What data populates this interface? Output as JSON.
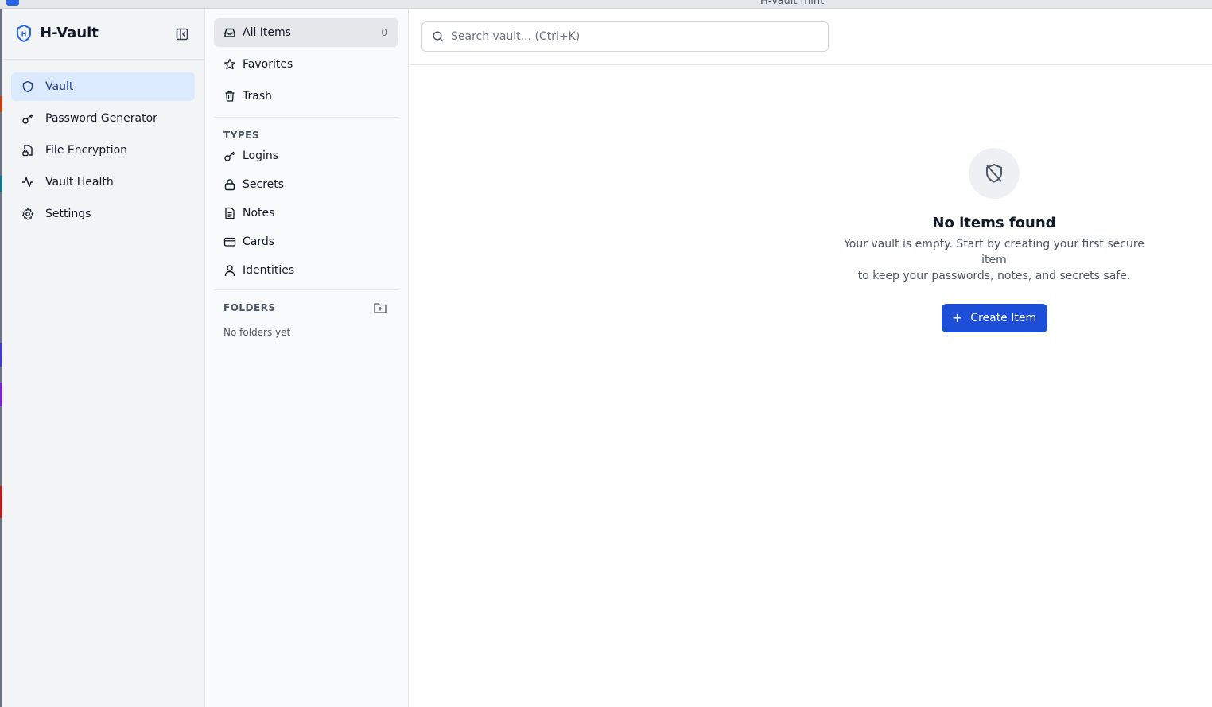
{
  "window": {
    "title": "H-Vault mint"
  },
  "brand": {
    "name": "H-Vault"
  },
  "sidebar": {
    "items": [
      {
        "label": "Vault",
        "icon": "shield-icon",
        "active": true
      },
      {
        "label": "Password Generator",
        "icon": "key-icon"
      },
      {
        "label": "File Encryption",
        "icon": "file-lock-icon"
      },
      {
        "label": "Vault Health",
        "icon": "activity-icon"
      },
      {
        "label": "Settings",
        "icon": "gear-icon"
      }
    ]
  },
  "filters": {
    "items": [
      {
        "label": "All Items",
        "count": "0",
        "icon": "inbox-icon",
        "active": true
      },
      {
        "label": "Favorites",
        "icon": "star-icon"
      },
      {
        "label": "Trash",
        "icon": "trash-icon"
      }
    ],
    "types_label": "TYPES",
    "types": [
      {
        "label": "Logins",
        "icon": "key-icon"
      },
      {
        "label": "Secrets",
        "icon": "lock-icon"
      },
      {
        "label": "Notes",
        "icon": "note-icon"
      },
      {
        "label": "Cards",
        "icon": "credit-card-icon"
      },
      {
        "label": "Identities",
        "icon": "user-icon"
      }
    ],
    "folders_label": "FOLDERS",
    "folders_empty": "No folders yet"
  },
  "search": {
    "placeholder": "Search vault... (Ctrl+K)",
    "value": ""
  },
  "empty_state": {
    "title": "No items found",
    "description_line1": "Your vault is empty. Start by creating your first secure item",
    "description_line2": "to keep your passwords, notes, and secrets safe.",
    "button_label": "Create Item"
  },
  "colors": {
    "accent": "#1d4ed8",
    "active_nav_bg": "#dbeafe",
    "sidebar_bg": "#f3f4f6"
  }
}
